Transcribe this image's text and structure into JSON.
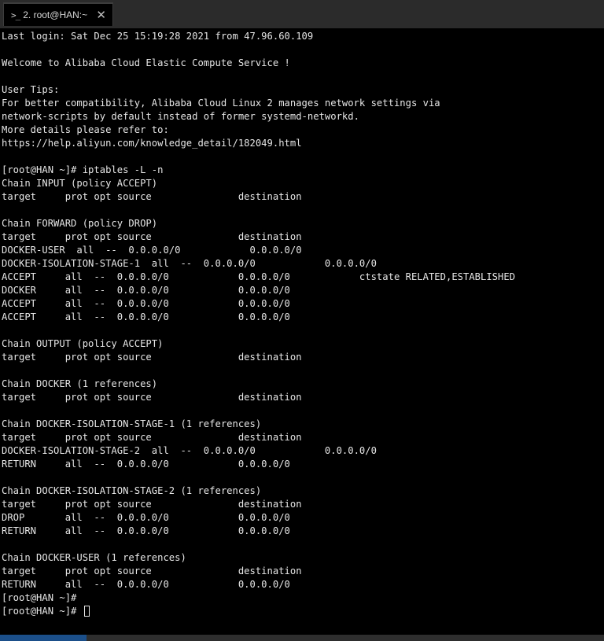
{
  "tab": {
    "icon": ">_",
    "label": "2. root@HAN:~",
    "close": "✕"
  },
  "terminal": {
    "lines": [
      "Last login: Sat Dec 25 15:19:28 2021 from 47.96.60.109",
      "",
      "Welcome to Alibaba Cloud Elastic Compute Service !",
      "",
      "User Tips:",
      "For better compatibility, Alibaba Cloud Linux 2 manages network settings via",
      "network-scripts by default instead of former systemd-networkd.",
      "More details please refer to:",
      "https://help.aliyun.com/knowledge_detail/182049.html",
      "",
      "[root@HAN ~]# iptables -L -n",
      "Chain INPUT (policy ACCEPT)",
      "target     prot opt source               destination",
      "",
      "Chain FORWARD (policy DROP)",
      "target     prot opt source               destination",
      "DOCKER-USER  all  --  0.0.0.0/0            0.0.0.0/0",
      "DOCKER-ISOLATION-STAGE-1  all  --  0.0.0.0/0            0.0.0.0/0",
      "ACCEPT     all  --  0.0.0.0/0            0.0.0.0/0            ctstate RELATED,ESTABLISHED",
      "DOCKER     all  --  0.0.0.0/0            0.0.0.0/0",
      "ACCEPT     all  --  0.0.0.0/0            0.0.0.0/0",
      "ACCEPT     all  --  0.0.0.0/0            0.0.0.0/0",
      "",
      "Chain OUTPUT (policy ACCEPT)",
      "target     prot opt source               destination",
      "",
      "Chain DOCKER (1 references)",
      "target     prot opt source               destination",
      "",
      "Chain DOCKER-ISOLATION-STAGE-1 (1 references)",
      "target     prot opt source               destination",
      "DOCKER-ISOLATION-STAGE-2  all  --  0.0.0.0/0            0.0.0.0/0",
      "RETURN     all  --  0.0.0.0/0            0.0.0.0/0",
      "",
      "Chain DOCKER-ISOLATION-STAGE-2 (1 references)",
      "target     prot opt source               destination",
      "DROP       all  --  0.0.0.0/0            0.0.0.0/0",
      "RETURN     all  --  0.0.0.0/0            0.0.0.0/0",
      "",
      "Chain DOCKER-USER (1 references)",
      "target     prot opt source               destination",
      "RETURN     all  --  0.0.0.0/0            0.0.0.0/0",
      "[root@HAN ~]#",
      "[root@HAN ~]# "
    ]
  },
  "colors": {
    "background": "#000000",
    "foreground": "#e6e6e6",
    "tabbar": "#2b2b2b",
    "status_accent": "#1b4f8a"
  }
}
